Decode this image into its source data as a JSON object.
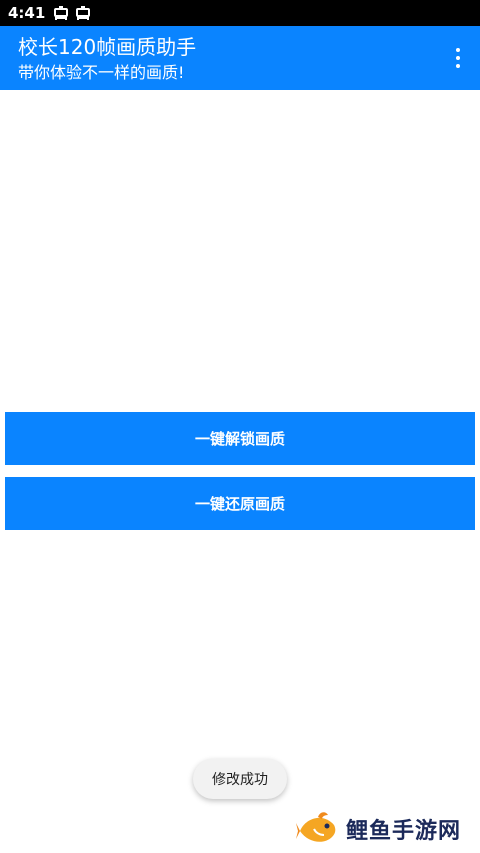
{
  "status_bar": {
    "time": "4:41",
    "notification_icons": [
      "bug-notification-icon",
      "bug-notification-icon"
    ]
  },
  "app_bar": {
    "title": "校长120帧画质助手",
    "subtitle": "带你体验不一样的画质!",
    "background": "#0a84ff"
  },
  "actions": {
    "unlock_label": "一键解锁画质",
    "restore_label": "一键还原画质",
    "accent": "#0a84ff"
  },
  "toast": {
    "message": "修改成功"
  },
  "watermark": {
    "text": "鲤鱼手游网",
    "logo_icon": "fish-logo-icon"
  }
}
